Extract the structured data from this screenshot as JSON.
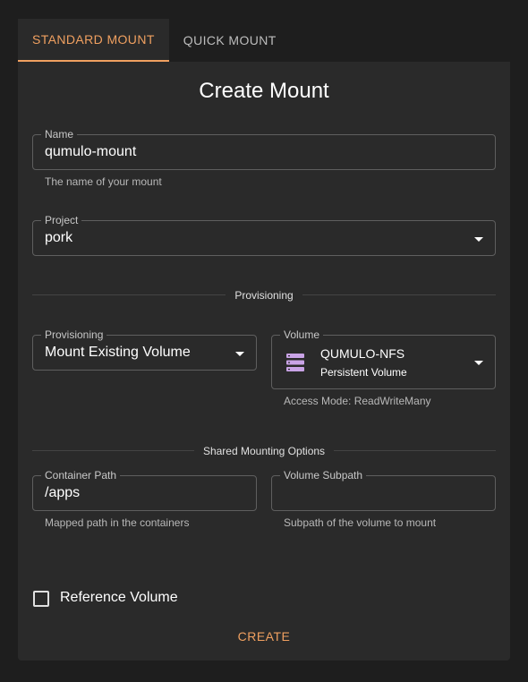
{
  "tabs": [
    {
      "label": "STANDARD MOUNT",
      "active": true
    },
    {
      "label": "QUICK MOUNT",
      "active": false
    }
  ],
  "form": {
    "title": "Create Mount",
    "name": {
      "label": "Name",
      "value": "qumulo-mount",
      "helper": "The name of your mount"
    },
    "project": {
      "label": "Project",
      "value": "pork"
    },
    "provisioning_section": "Provisioning",
    "provisioning": {
      "label": "Provisioning",
      "value": "Mount Existing Volume"
    },
    "volume": {
      "label": "Volume",
      "name": "QUMULO-NFS",
      "type": "Persistent Volume",
      "icon": "server-storage-icon",
      "helper": "Access Mode: ReadWriteMany"
    },
    "shared_section": "Shared Mounting Options",
    "container_path": {
      "label": "Container Path",
      "value": "/apps",
      "helper": "Mapped path in the containers"
    },
    "volume_subpath": {
      "label": "Volume Subpath",
      "value": "",
      "helper": "Subpath of the volume to mount"
    },
    "reference_volume": {
      "label": "Reference Volume",
      "checked": false
    },
    "create_label": "CREATE"
  },
  "colors": {
    "accent": "#f0a060",
    "background": "#1e1e1e",
    "card": "#2a2a2a",
    "icon": "#c9a3e6"
  }
}
